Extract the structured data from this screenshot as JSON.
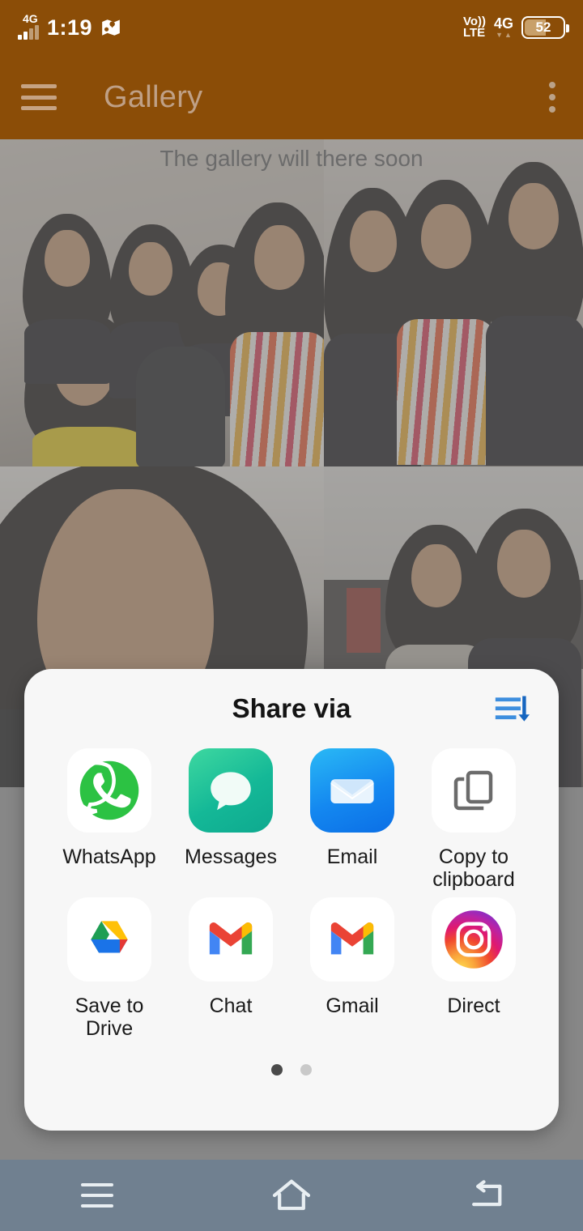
{
  "status_bar": {
    "network_type": "4G",
    "time": "1:19",
    "map_icon": "map-location-icon",
    "volte_line1": "Vo))",
    "volte_line2": "LTE",
    "network_right": "4G",
    "battery_percent": "52"
  },
  "app_bar": {
    "menu_icon": "hamburger-menu-icon",
    "title": "Gallery",
    "overflow_icon": "overflow-menu-icon"
  },
  "gallery": {
    "note": "The gallery will there soon",
    "photos": [
      {
        "alt": "group photo of five women in beige room"
      },
      {
        "alt": "three women smiling, one with glasses"
      },
      {
        "alt": "close-up portrait of smiling woman"
      },
      {
        "alt": "two young women, one wearing mask on chin"
      }
    ]
  },
  "share_sheet": {
    "title": "Share via",
    "sort_icon": "sort-list-icon",
    "apps": [
      {
        "label": "WhatsApp",
        "icon": "whatsapp-icon"
      },
      {
        "label": "Messages",
        "icon": "messages-icon"
      },
      {
        "label": "Email",
        "icon": "email-icon"
      },
      {
        "label": "Copy to clipboard",
        "icon": "copy-to-clipboard-icon"
      },
      {
        "label": "Save to Drive",
        "icon": "google-drive-icon"
      },
      {
        "label": "Chat",
        "icon": "google-chat-gmail-icon"
      },
      {
        "label": "Gmail",
        "icon": "gmail-icon"
      },
      {
        "label": "Direct",
        "icon": "instagram-icon"
      }
    ],
    "pager": {
      "total": 2,
      "active": 1
    }
  },
  "nav_bar": {
    "recents_icon": "recents-menu-icon",
    "home_icon": "home-icon",
    "back_icon": "back-icon"
  },
  "colors": {
    "toolbar": "#8b4d07",
    "sheet_bg": "#f7f7f7",
    "scrim": "#9a9a9a",
    "nav_bar": "#708090",
    "accent_blue": "#3d8ede"
  }
}
